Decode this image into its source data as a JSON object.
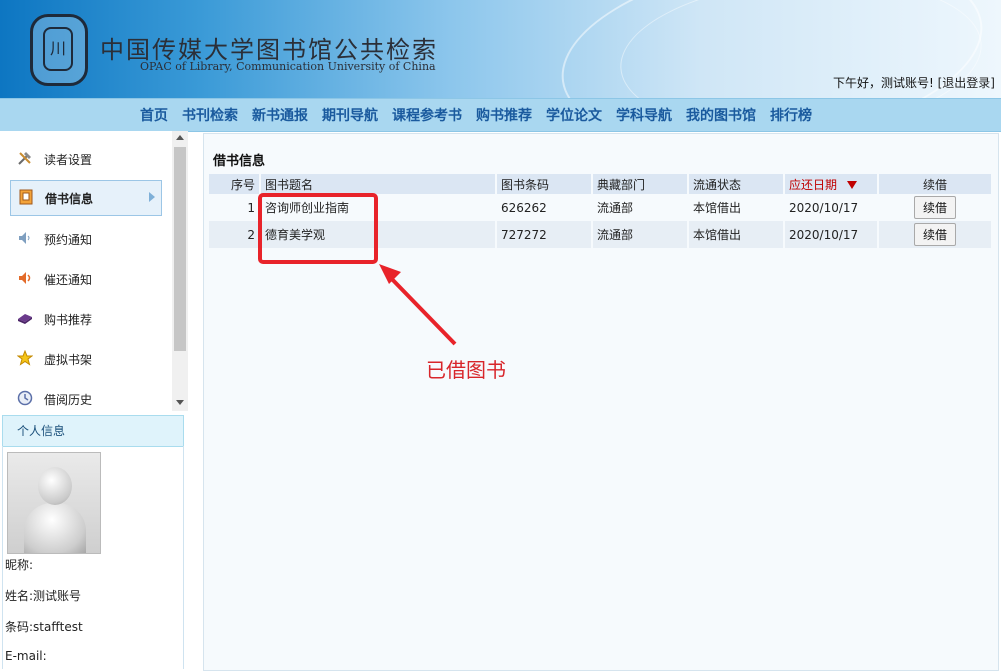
{
  "header": {
    "logo_text": "川",
    "title": "中国传媒大学图书馆公共检索",
    "subtitle": "OPAC of Library, Communication University of China",
    "greeting": "下午好，测试账号!",
    "logout_label": "[退出登录]"
  },
  "nav": {
    "items": [
      "首页",
      "书刊检索",
      "新书通报",
      "期刊导航",
      "课程参考书",
      "购书推荐",
      "学位论文",
      "学科导航",
      "我的图书馆",
      "排行榜"
    ]
  },
  "sidebar": {
    "menu": [
      {
        "label": "读者设置",
        "icon": "tools-icon"
      },
      {
        "label": "借书信息",
        "icon": "book-loan-icon",
        "active": true
      },
      {
        "label": "预约通知",
        "icon": "speaker-icon"
      },
      {
        "label": "催还通知",
        "icon": "speaker-loud-icon"
      },
      {
        "label": "购书推荐",
        "icon": "purple-book-icon"
      },
      {
        "label": "虚拟书架",
        "icon": "star-icon"
      },
      {
        "label": "借阅历史",
        "icon": "clock-icon"
      }
    ],
    "profile": {
      "title": "个人信息",
      "nickname_label": "昵称:",
      "name_label": "姓名:",
      "name_value": "测试账号",
      "barcode_label": "条码:",
      "barcode_value": "stafftest",
      "email_label": "E-mail:"
    }
  },
  "main": {
    "section_title": "借书信息",
    "columns": {
      "index": "序号",
      "title": "图书题名",
      "barcode": "图书条码",
      "location": "典藏部门",
      "status": "流通状态",
      "due": "应还日期",
      "renew": "续借"
    },
    "rows": [
      {
        "index": "1",
        "title": "咨询师创业指南",
        "barcode": "626262",
        "location": "流通部",
        "status": "本馆借出",
        "due": "2020/10/17",
        "renew": "续借"
      },
      {
        "index": "2",
        "title": "德育美学观",
        "barcode": "727272",
        "location": "流通部",
        "status": "本馆借出",
        "due": "2020/10/17",
        "renew": "续借"
      }
    ]
  },
  "annotation": {
    "label": "已借图书",
    "color": "#e8232a"
  }
}
